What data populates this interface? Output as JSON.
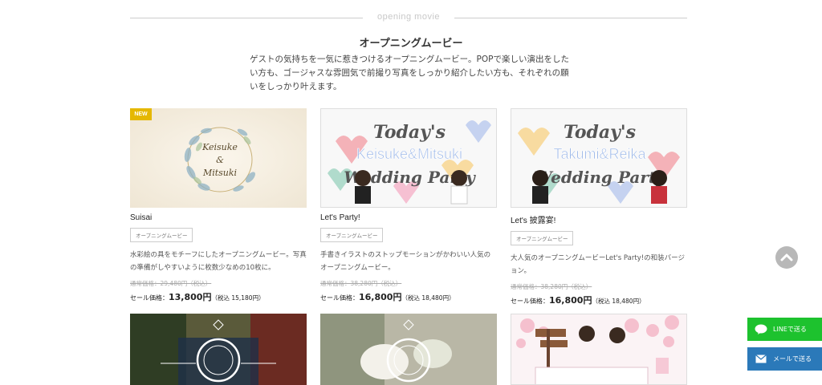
{
  "section": {
    "en_heading": "opening movie",
    "title": "オープニングムービー",
    "intro": "ゲストの気持ちを一気に惹きつけるオープニングムービー。POPで楽しい演出をしたい方も、ゴージャスな雰囲気で前撮り写真をしっかり紹介したい方も、それぞれの願いをしっかり叶えます。"
  },
  "cards": [
    {
      "badge": "NEW",
      "image_alt": "Keisuke & Mitsuki watercolor wreath",
      "thumb_text_1": "Keisuke",
      "thumb_text_2": "&",
      "thumb_text_3": "Mitsuki",
      "name": "Suisai",
      "tag": "オープニングムービー",
      "desc": "水彩絵の具をモチーフにしたオープニングムービー。写真の準備がしやすいように枚数少なめの10枚に。",
      "old_price": "通常価格：29,480円（税込）",
      "sale_label": "セール価格：",
      "sale_price": "13,800円",
      "sale_tax": "（税込 15,180円）"
    },
    {
      "badge": "",
      "thumb_text_1": "Today's",
      "thumb_text_2": "Keisuke&Mitsuki",
      "thumb_text_3": "Wedding Party",
      "name": "Let's Party!",
      "tag": "オープニングムービー",
      "desc": "手書きイラストのストップモーションがかわいい人気のオープニングムービー。",
      "old_price": "通常価格：38,280円（税込）",
      "sale_label": "セール価格：",
      "sale_price": "16,800円",
      "sale_tax": "（税込 18,480円）"
    },
    {
      "badge": "",
      "thumb_text_1": "Today's",
      "thumb_text_2": "Takumi&Reika",
      "thumb_text_3": "Wedding Party",
      "name": "Let's 披露宴!",
      "tag": "オープニングムービー",
      "desc": "大人気のオープニングムービーLet's Party!の和装バージョン。",
      "old_price": "通常価格：38,280円（税込）",
      "sale_label": "セール価格：",
      "sale_price": "16,800円",
      "sale_tax": "（税込 18,480円）"
    }
  ],
  "share": {
    "line_label": "LINEで送る",
    "mail_label": "メールで送る"
  },
  "colors": {
    "new_badge": "#e5b800",
    "line_green": "#1dc22e",
    "mail_blue": "#2b79b9"
  }
}
